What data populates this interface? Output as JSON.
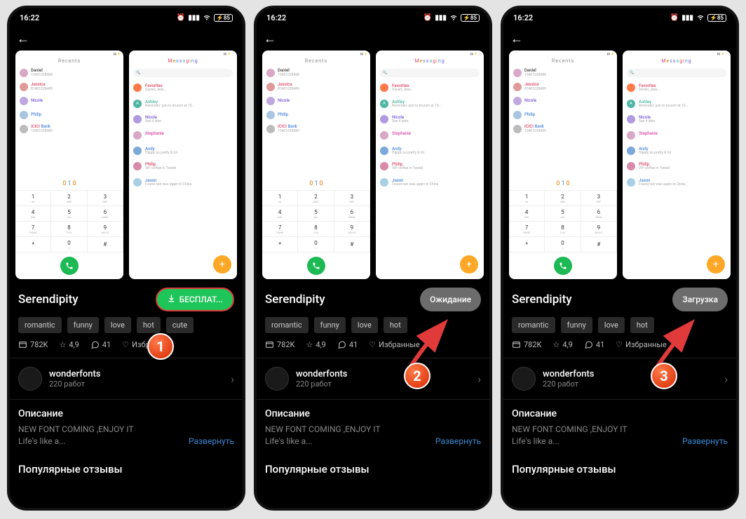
{
  "statusbar": {
    "time": "16:22",
    "battery": "85"
  },
  "preview_dialer": {
    "header": "Recents",
    "contacts": [
      {
        "name": "Daniel",
        "sub": "15401028488",
        "color": "#d9a8c6"
      },
      {
        "name": "Jessica",
        "sub": "87401028489",
        "color": "#e19a9a"
      },
      {
        "name": "Nicole",
        "sub": "",
        "color": "#bfa8e0"
      },
      {
        "name": "Philip",
        "sub": "",
        "color": "#a8c6e0"
      },
      {
        "name": "ICICI Bank",
        "sub": "15401028489",
        "color": "#bbb"
      }
    ],
    "digits": "010",
    "keys": [
      {
        "n": "1",
        "s": "∞"
      },
      {
        "n": "2",
        "s": "ABC"
      },
      {
        "n": "3",
        "s": "DEF"
      },
      {
        "n": "4",
        "s": "GHI"
      },
      {
        "n": "5",
        "s": "JKL"
      },
      {
        "n": "6",
        "s": "MNO"
      },
      {
        "n": "7",
        "s": "PQRS"
      },
      {
        "n": "8",
        "s": "TUV"
      },
      {
        "n": "9",
        "s": "WXYZ"
      },
      {
        "n": "*",
        "s": ""
      },
      {
        "n": "0",
        "s": "+"
      },
      {
        "n": "#",
        "s": ""
      }
    ]
  },
  "preview_messages": {
    "header": "Messaging",
    "search_placeholder": "Search",
    "threads": [
      {
        "name": "Favorites",
        "sub": "Daniel, Jess...",
        "color": "#ff7a4a"
      },
      {
        "name": "Ashley",
        "sub": "Reminder: join to brunch at 10...",
        "color": "#4db6a3"
      },
      {
        "name": "Nicole",
        "sub": "See it later",
        "color": "#b09ae0"
      },
      {
        "name": "Stephanie",
        "sub": "",
        "color": "#d9a8c6"
      },
      {
        "name": "Andy",
        "sub": "Happy so pretty & lot",
        "color": "#7ba9d9"
      },
      {
        "name": "Philip",
        "sub": "VIP coffee in Tweed",
        "color": "#d98aa8"
      },
      {
        "name": "Jason",
        "sub": "Found rain wax again in China",
        "color": "#a8d0e5"
      }
    ]
  },
  "theme": {
    "title": "Serendipity",
    "tags": [
      "romantic",
      "funny",
      "love",
      "hot",
      "cute"
    ],
    "tags_short": [
      "romantic",
      "funny",
      "love",
      "hot"
    ],
    "stats": {
      "downloads": "782K",
      "rating": "4,9",
      "comments": "41",
      "favorite": "Избранные"
    },
    "author": {
      "name": "wonderfonts",
      "works": "220 работ"
    },
    "description_heading": "Описание",
    "description_line1": "NEW FONT COMING ,ENJOY IT",
    "description_line2": "Life's like a...",
    "expand": "Развернуть",
    "reviews_heading": "Популярные отзывы"
  },
  "buttons": {
    "free": "БЕСПЛАТ...",
    "waiting": "Ожидание",
    "loading": "Загрузка"
  },
  "badges": {
    "one": "1",
    "two": "2",
    "three": "3"
  }
}
